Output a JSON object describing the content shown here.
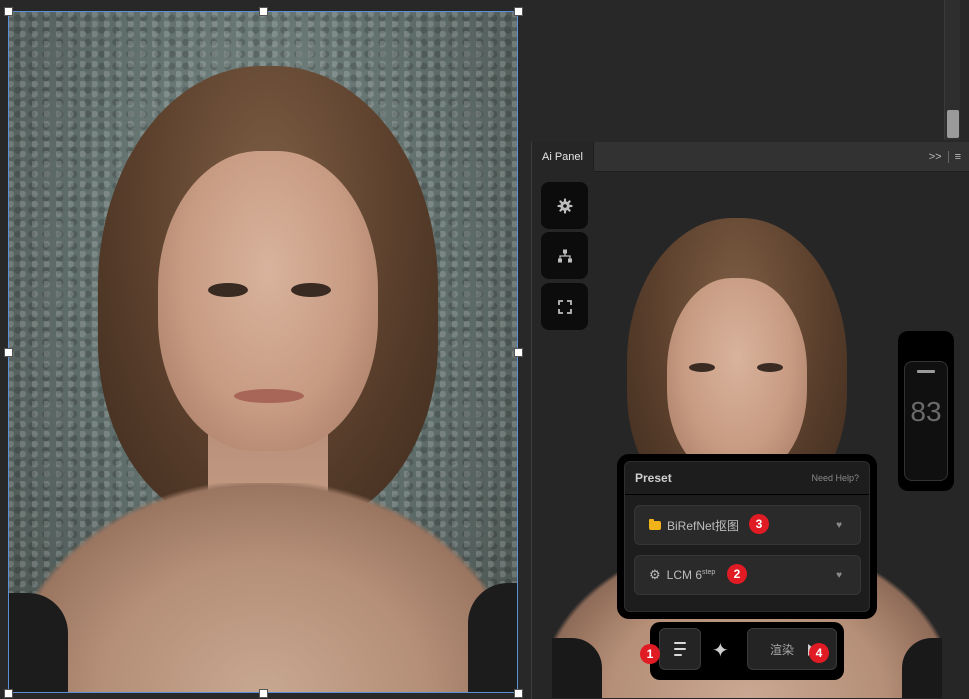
{
  "panel": {
    "tab_title": "Ai Panel",
    "menu_expand": ">>",
    "menu_icon": "≡"
  },
  "tools": [
    {
      "name": "settings",
      "icon": "gear-icon"
    },
    {
      "name": "workflow",
      "icon": "sitemap-icon"
    },
    {
      "name": "fullscreen",
      "icon": "expand-icon"
    }
  ],
  "slider": {
    "value": "83"
  },
  "preset": {
    "title": "Preset",
    "help": "Need Help?",
    "items": [
      {
        "label": "BiRefNet抠图",
        "icon": "folder-icon",
        "badge": "3"
      },
      {
        "label_main": "LCM 6",
        "label_sup": "step",
        "icon": "gear-icon",
        "badge": "2"
      }
    ]
  },
  "actionbar": {
    "list_badge": "1",
    "spark_icon": "✦",
    "render_label": "渲染",
    "render_badge": "4"
  },
  "colors": {
    "accent_badge": "#e01b24",
    "selection": "#5b8fd6",
    "folder": "#f2b21a"
  }
}
